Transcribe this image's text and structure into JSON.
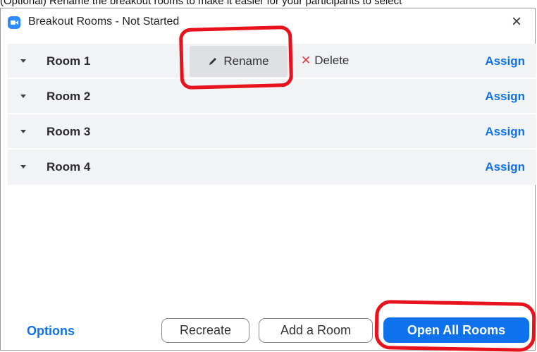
{
  "caption": "(Optional) Rename the breakout rooms to make it easier for your participants to select",
  "window": {
    "title": "Breakout Rooms - Not Started",
    "close_label": "×"
  },
  "rooms": [
    {
      "name": "Room 1",
      "assign_label": "Assign",
      "rename_label": "Rename",
      "delete_label": "Delete"
    },
    {
      "name": "Room 2",
      "assign_label": "Assign"
    },
    {
      "name": "Room 3",
      "assign_label": "Assign"
    },
    {
      "name": "Room 4",
      "assign_label": "Assign"
    }
  ],
  "footer": {
    "options_label": "Options",
    "recreate_label": "Recreate",
    "add_room_label": "Add a Room",
    "open_all_label": "Open All Rooms"
  },
  "colors": {
    "accent": "#0e72ed",
    "row_bg": "#f2f3f5",
    "annotation": "#e8121c",
    "delete_icon": "#e0383e"
  },
  "icons": [
    "zoom-app-icon",
    "close-icon",
    "caret-down-icon",
    "pencil-icon",
    "delete-x-icon"
  ]
}
